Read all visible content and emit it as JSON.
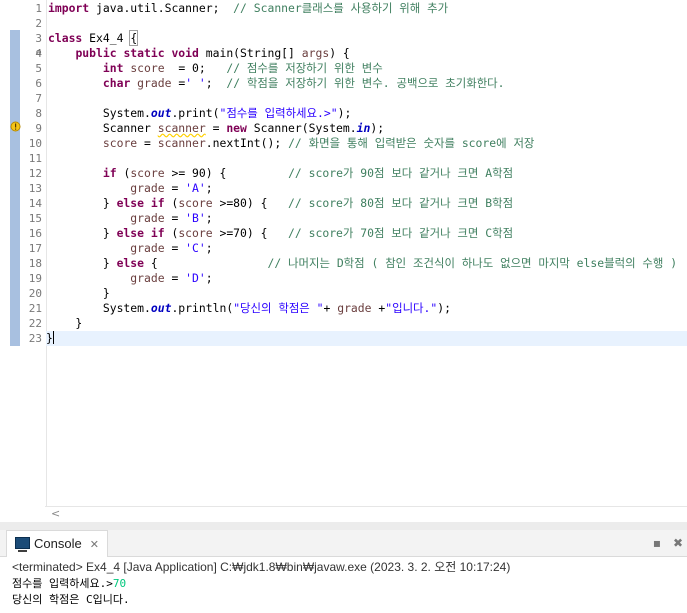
{
  "editor": {
    "line_numbers": [
      "1",
      "2",
      "3",
      "4",
      "5",
      "6",
      "7",
      "8",
      "9",
      "10",
      "11",
      "12",
      "13",
      "14",
      "15",
      "16",
      "17",
      "18",
      "19",
      "20",
      "21",
      "22",
      "23"
    ],
    "lines": [
      [
        {
          "t": "import",
          "c": "kw"
        },
        {
          "t": " java.util.Scanner;  ",
          "c": ""
        },
        {
          "t": "// Scanner클래스를 사용하기 위해 추가",
          "c": "cmt"
        }
      ],
      [],
      [
        {
          "t": "class",
          "c": "kw"
        },
        {
          "t": " Ex4_4 ",
          "c": ""
        },
        {
          "t": "{",
          "c": "bracket"
        }
      ],
      [
        {
          "t": "    ",
          "c": ""
        },
        {
          "t": "public static void",
          "c": "kw"
        },
        {
          "t": " main(String[] ",
          "c": ""
        },
        {
          "t": "args",
          "c": "var"
        },
        {
          "t": ") {",
          "c": ""
        }
      ],
      [
        {
          "t": "        ",
          "c": ""
        },
        {
          "t": "int",
          "c": "kw"
        },
        {
          "t": " ",
          "c": ""
        },
        {
          "t": "score",
          "c": "var"
        },
        {
          "t": "  = 0;   ",
          "c": ""
        },
        {
          "t": "// 점수를 저장하기 위한 변수",
          "c": "cmt"
        }
      ],
      [
        {
          "t": "        ",
          "c": ""
        },
        {
          "t": "char",
          "c": "kw"
        },
        {
          "t": " ",
          "c": ""
        },
        {
          "t": "grade",
          "c": "var"
        },
        {
          "t": " =",
          "c": ""
        },
        {
          "t": "' '",
          "c": "str"
        },
        {
          "t": ";  ",
          "c": ""
        },
        {
          "t": "// 학점을 저장하기 위한 변수. 공백으로 초기화한다.",
          "c": "cmt"
        }
      ],
      [],
      [
        {
          "t": "        System.",
          "c": ""
        },
        {
          "t": "out",
          "c": "fld"
        },
        {
          "t": ".print(",
          "c": ""
        },
        {
          "t": "\"점수를 입력하세요.>\"",
          "c": "str"
        },
        {
          "t": ");",
          "c": ""
        }
      ],
      [
        {
          "t": "        Scanner ",
          "c": ""
        },
        {
          "t": "scanner",
          "c": "var unused"
        },
        {
          "t": " = ",
          "c": ""
        },
        {
          "t": "new",
          "c": "kw"
        },
        {
          "t": " Scanner(System.",
          "c": ""
        },
        {
          "t": "in",
          "c": "fld"
        },
        {
          "t": ");",
          "c": ""
        }
      ],
      [
        {
          "t": "        ",
          "c": ""
        },
        {
          "t": "score",
          "c": "var"
        },
        {
          "t": " = ",
          "c": ""
        },
        {
          "t": "scanner",
          "c": "var"
        },
        {
          "t": ".nextInt(); ",
          "c": ""
        },
        {
          "t": "// 화면을 통해 입력받은 숫자를 score에 저장",
          "c": "cmt"
        }
      ],
      [],
      [
        {
          "t": "        ",
          "c": ""
        },
        {
          "t": "if",
          "c": "kw"
        },
        {
          "t": " (",
          "c": ""
        },
        {
          "t": "score",
          "c": "var"
        },
        {
          "t": " >= 90) {         ",
          "c": ""
        },
        {
          "t": "// score가 90점 보다 같거나 크면 A학점",
          "c": "cmt"
        }
      ],
      [
        {
          "t": "            ",
          "c": ""
        },
        {
          "t": "grade",
          "c": "var"
        },
        {
          "t": " = ",
          "c": ""
        },
        {
          "t": "'A'",
          "c": "str"
        },
        {
          "t": ";",
          "c": ""
        }
      ],
      [
        {
          "t": "        } ",
          "c": ""
        },
        {
          "t": "else if",
          "c": "kw"
        },
        {
          "t": " (",
          "c": ""
        },
        {
          "t": "score",
          "c": "var"
        },
        {
          "t": " >=80) {   ",
          "c": ""
        },
        {
          "t": "// score가 80점 보다 같거나 크면 B학점",
          "c": "cmt"
        }
      ],
      [
        {
          "t": "            ",
          "c": ""
        },
        {
          "t": "grade",
          "c": "var"
        },
        {
          "t": " = ",
          "c": ""
        },
        {
          "t": "'B'",
          "c": "str"
        },
        {
          "t": ";",
          "c": ""
        }
      ],
      [
        {
          "t": "        } ",
          "c": ""
        },
        {
          "t": "else if",
          "c": "kw"
        },
        {
          "t": " (",
          "c": ""
        },
        {
          "t": "score",
          "c": "var"
        },
        {
          "t": " >=70) {   ",
          "c": ""
        },
        {
          "t": "// score가 70점 보다 같거나 크면 C학점",
          "c": "cmt"
        }
      ],
      [
        {
          "t": "            ",
          "c": ""
        },
        {
          "t": "grade",
          "c": "var"
        },
        {
          "t": " = ",
          "c": ""
        },
        {
          "t": "'C'",
          "c": "str"
        },
        {
          "t": ";",
          "c": ""
        }
      ],
      [
        {
          "t": "        } ",
          "c": ""
        },
        {
          "t": "else",
          "c": "kw"
        },
        {
          "t": " {                ",
          "c": ""
        },
        {
          "t": "// 나머지는 D학점 ( 참인 조건식이 하나도 없으면 마지막 else블럭의 수행 )",
          "c": "cmt"
        }
      ],
      [
        {
          "t": "            ",
          "c": ""
        },
        {
          "t": "grade",
          "c": "var"
        },
        {
          "t": " = ",
          "c": ""
        },
        {
          "t": "'D'",
          "c": "str"
        },
        {
          "t": ";",
          "c": ""
        }
      ],
      [
        {
          "t": "        }",
          "c": ""
        }
      ],
      [
        {
          "t": "        System.",
          "c": ""
        },
        {
          "t": "out",
          "c": "fld"
        },
        {
          "t": ".println(",
          "c": ""
        },
        {
          "t": "\"당신의 학점은 \"",
          "c": "str"
        },
        {
          "t": "+ ",
          "c": ""
        },
        {
          "t": "grade",
          "c": "var"
        },
        {
          "t": " +",
          "c": ""
        },
        {
          "t": "\"입니다.\"",
          "c": "str"
        },
        {
          "t": ");",
          "c": ""
        }
      ],
      [
        {
          "t": "    }",
          "c": ""
        }
      ],
      [
        {
          "t": "}",
          "c": ""
        }
      ]
    ]
  },
  "console": {
    "tab_label": "Console",
    "tab_close": "✕",
    "status": "<terminated> Ex4_4 [Java Application] C:₩jdk1.8₩bin₩javaw.exe (2023. 3. 2. 오전 10:17:24)",
    "prompt": "점수를 입력하세요.>",
    "user_input": "70",
    "result": "당신의 학점은 C입니다."
  }
}
